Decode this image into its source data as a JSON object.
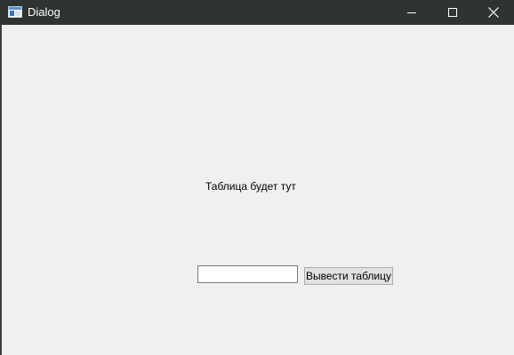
{
  "window": {
    "title": "Dialog",
    "app_icon": "window-app-icon",
    "controls": {
      "minimize_icon": "minimize-icon",
      "maximize_icon": "maximize-icon",
      "close_icon": "close-icon"
    },
    "colors": {
      "titlebar_bg": "#2f3430",
      "titlebar_text": "#ffffff",
      "client_bg": "#f0f0f0"
    }
  },
  "main": {
    "table_label": "Таблица будет тут",
    "input": {
      "value": "",
      "placeholder": ""
    },
    "show_table_button": "Вывести таблицу"
  }
}
